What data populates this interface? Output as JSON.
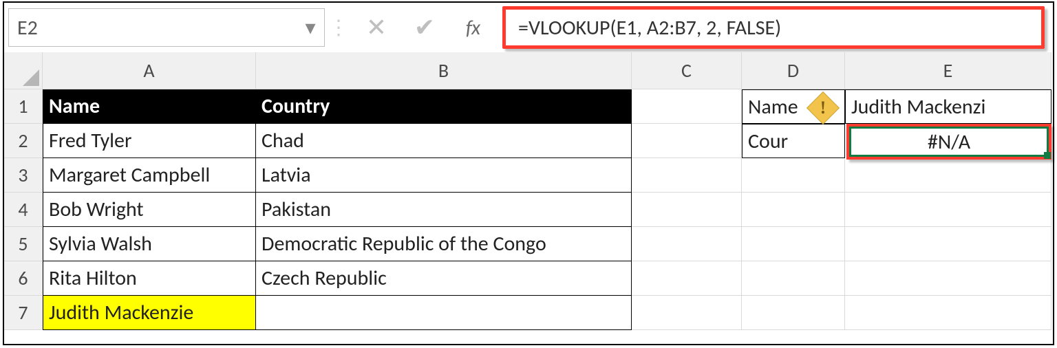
{
  "namebox": {
    "value": "E2"
  },
  "formula_bar": {
    "formula": "=VLOOKUP(E1, A2:B7, 2, FALSE)"
  },
  "columns": [
    "A",
    "B",
    "C",
    "D",
    "E"
  ],
  "row_numbers": [
    "1",
    "2",
    "3",
    "4",
    "5",
    "6",
    "7"
  ],
  "table": {
    "headers": {
      "name": "Name",
      "country": "Country"
    },
    "rows": [
      {
        "name": "Fred Tyler",
        "country": "Chad"
      },
      {
        "name": "Margaret Campbell",
        "country": "Latvia"
      },
      {
        "name": "Bob Wright",
        "country": "Pakistan"
      },
      {
        "name": "Sylvia Walsh",
        "country": "Democratic Republic of the Congo"
      },
      {
        "name": "Rita Hilton",
        "country": "Czech Republic"
      },
      {
        "name": "Judith Mackenzie",
        "country": ""
      }
    ],
    "highlight_row_index": 5
  },
  "lookup": {
    "d1": "Name",
    "e1": "Judith Mackenzi",
    "d2": "Cour",
    "e2": "#N/A"
  },
  "icons": {
    "fx": "fx",
    "cancel": "✕",
    "enter": "✔",
    "dropdown": "▾",
    "sep": "⋮",
    "error": "!"
  }
}
